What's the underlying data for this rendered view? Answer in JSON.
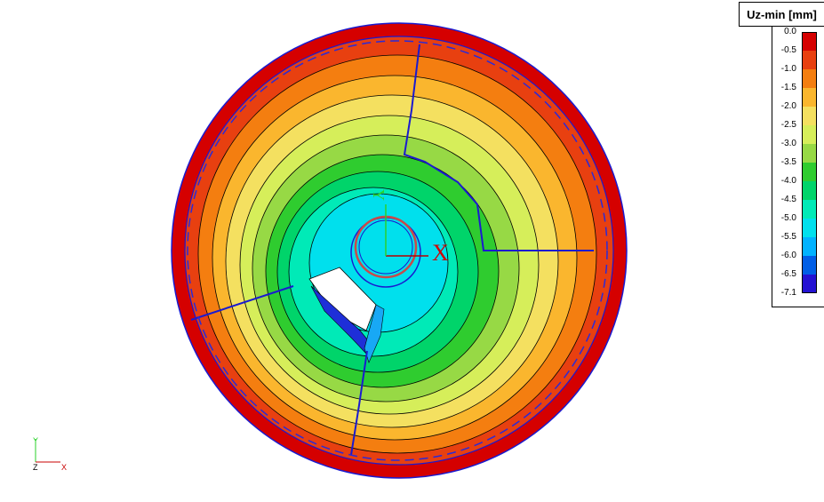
{
  "legend": {
    "title": "Uz-min [mm]",
    "ticks": [
      "0.0",
      "-0.5",
      "-1.0",
      "-1.5",
      "-2.0",
      "-2.5",
      "-3.0",
      "-3.5",
      "-4.0",
      "-4.5",
      "-5.0",
      "-5.5",
      "-6.0",
      "-6.5",
      "-7.1"
    ],
    "colors": [
      "#d50000",
      "#e84010",
      "#f47e10",
      "#fab62e",
      "#f4e060",
      "#d6ee5a",
      "#97d945",
      "#2fcc2f",
      "#00d46a",
      "#00eab7",
      "#00e0ed",
      "#00b2ff",
      "#005ee6",
      "#2412d2"
    ]
  },
  "plot": {
    "outer_ring_color": "#d50000",
    "axis_labels": {
      "x": "X",
      "y": "Y"
    }
  },
  "triad": {
    "y": "Y",
    "z": "Z",
    "x": "X"
  }
}
